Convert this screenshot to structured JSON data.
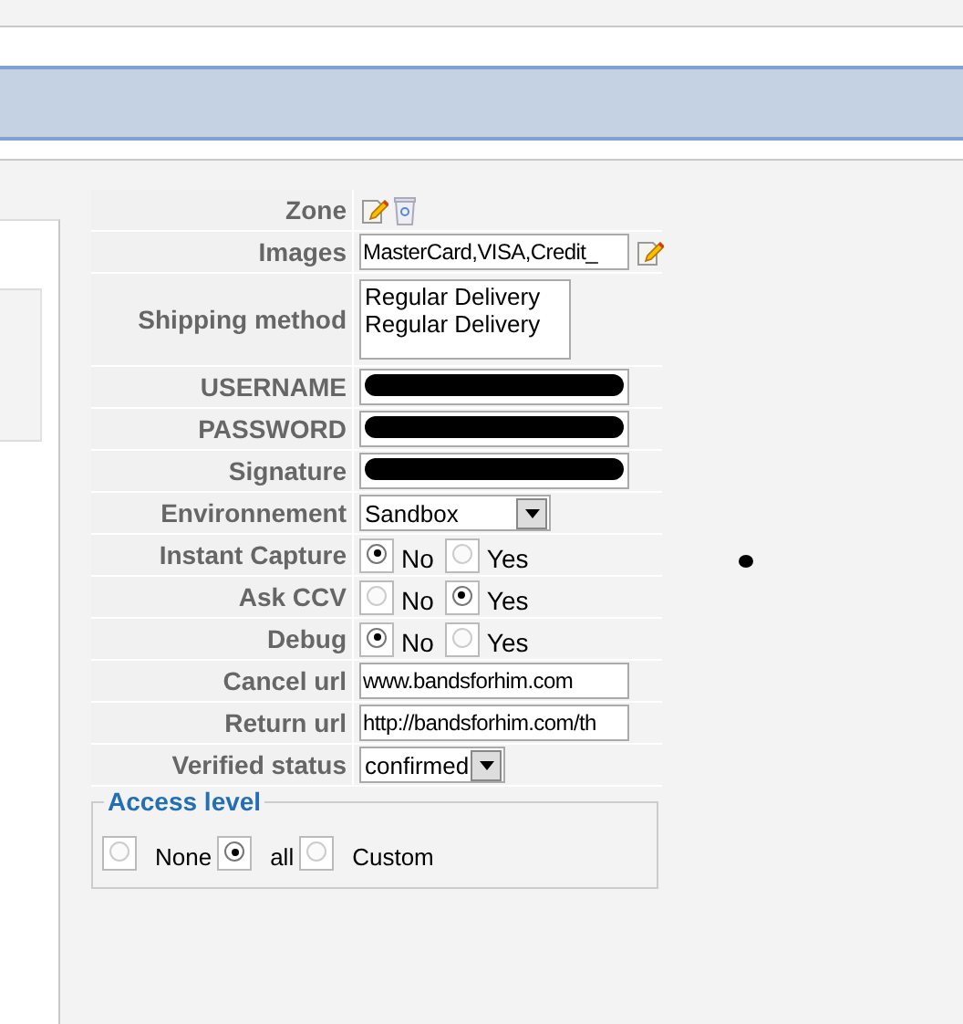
{
  "rows": [
    {
      "kind": "icons",
      "label": "Zone"
    },
    {
      "kind": "text-edit",
      "label": "Images",
      "value": "MasterCard,VISA,Credit_"
    },
    {
      "kind": "listbox",
      "label": "Shipping method",
      "options": [
        "Regular Delivery",
        "Regular Delivery"
      ]
    },
    {
      "kind": "redacted",
      "label": "USERNAME"
    },
    {
      "kind": "redacted",
      "label": "PASSWORD"
    },
    {
      "kind": "redacted",
      "label": "Signature"
    },
    {
      "kind": "select",
      "label": "Environnement",
      "value": "Sandbox"
    },
    {
      "kind": "radio",
      "label": "Instant Capture",
      "options": [
        {
          "label": "No",
          "selected": true
        },
        {
          "label": "Yes",
          "selected": false
        }
      ]
    },
    {
      "kind": "radio",
      "label": "Ask CCV",
      "options": [
        {
          "label": "No",
          "selected": false
        },
        {
          "label": "Yes",
          "selected": true
        }
      ]
    },
    {
      "kind": "radio",
      "label": "Debug",
      "options": [
        {
          "label": "No",
          "selected": true
        },
        {
          "label": "Yes",
          "selected": false
        }
      ]
    },
    {
      "kind": "text",
      "label": "Cancel url",
      "value": "www.bandsforhim.com"
    },
    {
      "kind": "text",
      "label": "Return url",
      "value": "http://bandsforhim.com/th"
    },
    {
      "kind": "select-small",
      "label": "Verified status",
      "value": "confirmed"
    }
  ],
  "access_level": {
    "legend": "Access level",
    "options": [
      {
        "label": "None",
        "selected": false
      },
      {
        "label": "all",
        "selected": true
      },
      {
        "label": "Custom",
        "selected": false
      }
    ]
  }
}
